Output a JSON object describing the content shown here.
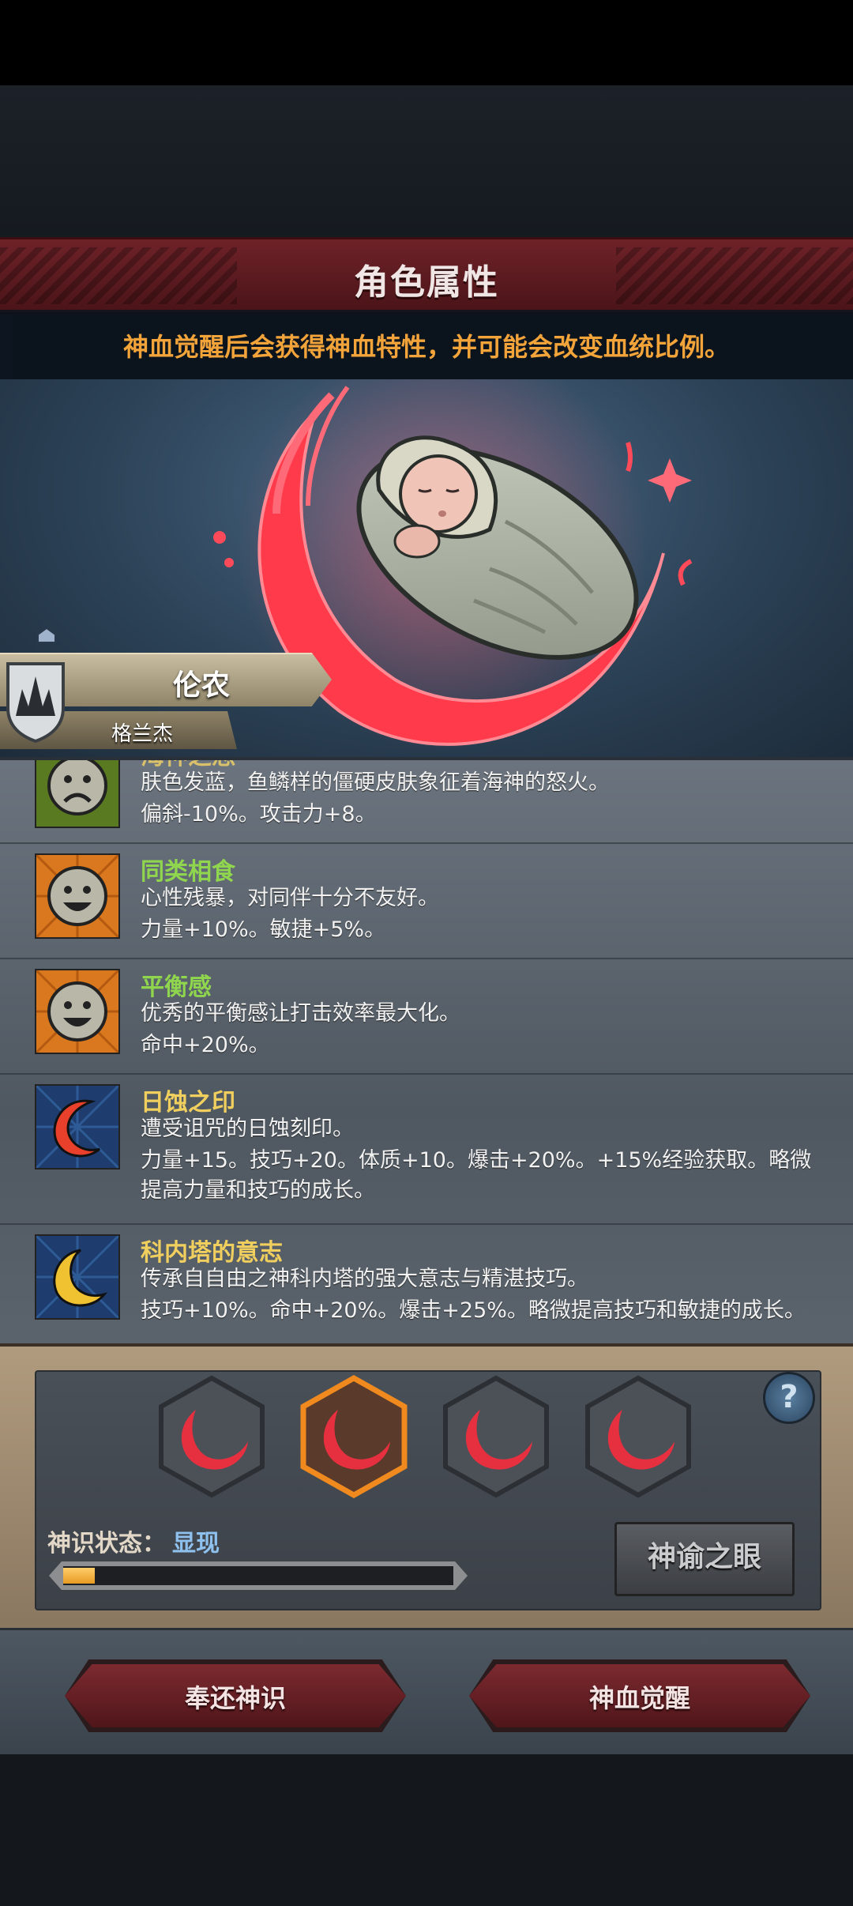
{
  "header": {
    "title": "角色属性"
  },
  "notice": "神血觉醒后会获得神血特性，并可能会改变血统比例。",
  "character": {
    "name": "伦农",
    "house": "格兰杰"
  },
  "traits": [
    {
      "name": "海神之怒",
      "name_color": "#d9c06a",
      "icon": "sad-face-icon",
      "desc1": "肤色发蓝，鱼鳞样的僵硬皮肤象征着海神的怒火。",
      "desc2": "偏斜-10%。攻击力+8。"
    },
    {
      "name": "同类相食",
      "name_color": "#8fd64e",
      "icon": "smile-face-icon",
      "desc1": "心性残暴，对同伴十分不友好。",
      "desc2": "力量+10%。敏捷+5%。"
    },
    {
      "name": "平衡感",
      "name_color": "#8fd64e",
      "icon": "smile-face-icon",
      "desc1": "优秀的平衡感让打击效率最大化。",
      "desc2": "命中+20%。"
    },
    {
      "name": "日蚀之印",
      "name_color": "#f0cf5e",
      "icon": "red-crescent-icon",
      "desc1": "遭受诅咒的日蚀刻印。",
      "desc2": "力量+15。技巧+20。体质+10。爆击+20%。+15%经验获取。略微提高力量和技巧的成长。"
    },
    {
      "name": "科内塔的意志",
      "name_color": "#f0cf5e",
      "icon": "gold-crescent-icon",
      "desc1": "传承自自由之神科内塔的强大意志与精湛技巧。",
      "desc2": "技巧+10%。命中+20%。爆击+25%。略微提高技巧和敏捷的成长。"
    }
  ],
  "bloodline_slots": [
    {
      "icon": "red-crescent-icon",
      "selected": false
    },
    {
      "icon": "red-crescent-icon",
      "selected": true
    },
    {
      "icon": "red-crescent-icon",
      "selected": false
    },
    {
      "icon": "red-crescent-icon",
      "selected": false
    }
  ],
  "status": {
    "label": "神识状态：",
    "value": "显现",
    "progress": 0.08
  },
  "help_label": "?",
  "oracle_button": "神谕之眼",
  "footer": {
    "return_button": "奉还神识",
    "awaken_button": "神血觉醒"
  },
  "colors": {
    "accent_red": "#e63040",
    "gold": "#f2a43a",
    "status_blue": "#8fc1ef"
  }
}
